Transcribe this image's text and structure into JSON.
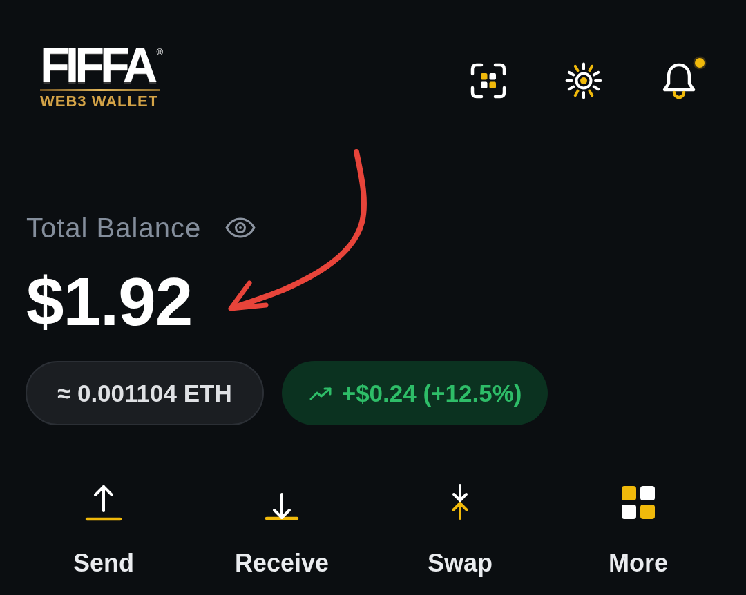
{
  "header": {
    "logo": {
      "wordmark": "FIFFA",
      "registered_mark": "®",
      "tagline": "WEB3 WALLET"
    },
    "actions": [
      {
        "kind": "scan",
        "badge": false
      },
      {
        "kind": "theme",
        "badge": false
      },
      {
        "kind": "notifications",
        "badge": true
      }
    ]
  },
  "balance": {
    "label": "Total Balance",
    "amount": "$1.92",
    "crypto_equivalent": "≈ 0.001104 ETH",
    "change": {
      "positive": true,
      "text": "+$0.24 (+12.5%)"
    }
  },
  "quick_actions": [
    {
      "kind": "send",
      "label": "Send"
    },
    {
      "kind": "receive",
      "label": "Receive"
    },
    {
      "kind": "swap",
      "label": "Swap"
    },
    {
      "kind": "more",
      "label": "More"
    }
  ],
  "annotations": [
    {
      "kind": "arrow"
    }
  ]
}
